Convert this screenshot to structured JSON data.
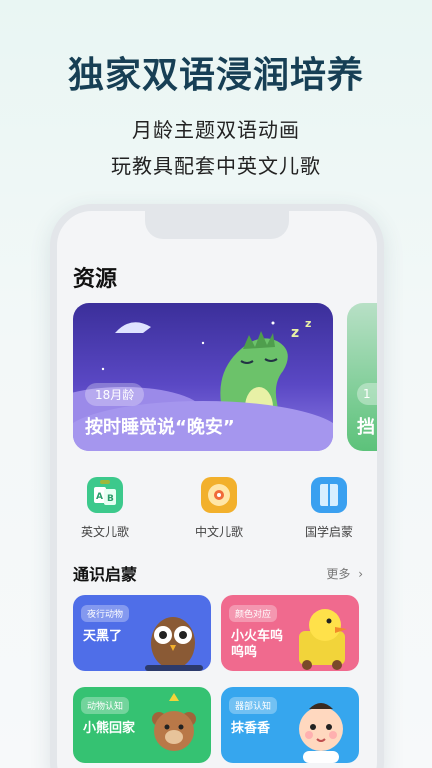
{
  "promo": {
    "title": "独家双语浸润培养",
    "line1": "月龄主题双语动画",
    "line2": "玩教具配套中英文儿歌"
  },
  "app": {
    "section_title": "资源",
    "banner": {
      "age": "18月龄",
      "title": "按时睡觉说“晚安”"
    },
    "banner_peek": {
      "age": "1",
      "title": "挡"
    },
    "categories": [
      {
        "label": "英文儿歌",
        "icon": "abc-cards-icon",
        "color": "#3cc98c"
      },
      {
        "label": "中文儿歌",
        "icon": "music-disc-icon",
        "color": "#f2b02c"
      },
      {
        "label": "国学启蒙",
        "icon": "book-icon",
        "color": "#3aa0f0"
      }
    ],
    "cards_section": {
      "title": "通识启蒙",
      "more": "更多"
    },
    "cards": [
      {
        "tag": "夜行动物",
        "title": "天黑了",
        "color": "#4f6ee8",
        "icon": "owl-icon"
      },
      {
        "tag": "颜色对应",
        "title": "小火车呜呜呜",
        "color": "#f06a8e",
        "icon": "duck-icon"
      },
      {
        "tag": "动物认知",
        "title": "小熊回家",
        "color": "#35c272",
        "icon": "bear-icon"
      },
      {
        "tag": "器部认知",
        "title": "抹香香",
        "color": "#36a6ee",
        "icon": "baby-icon"
      }
    ]
  }
}
